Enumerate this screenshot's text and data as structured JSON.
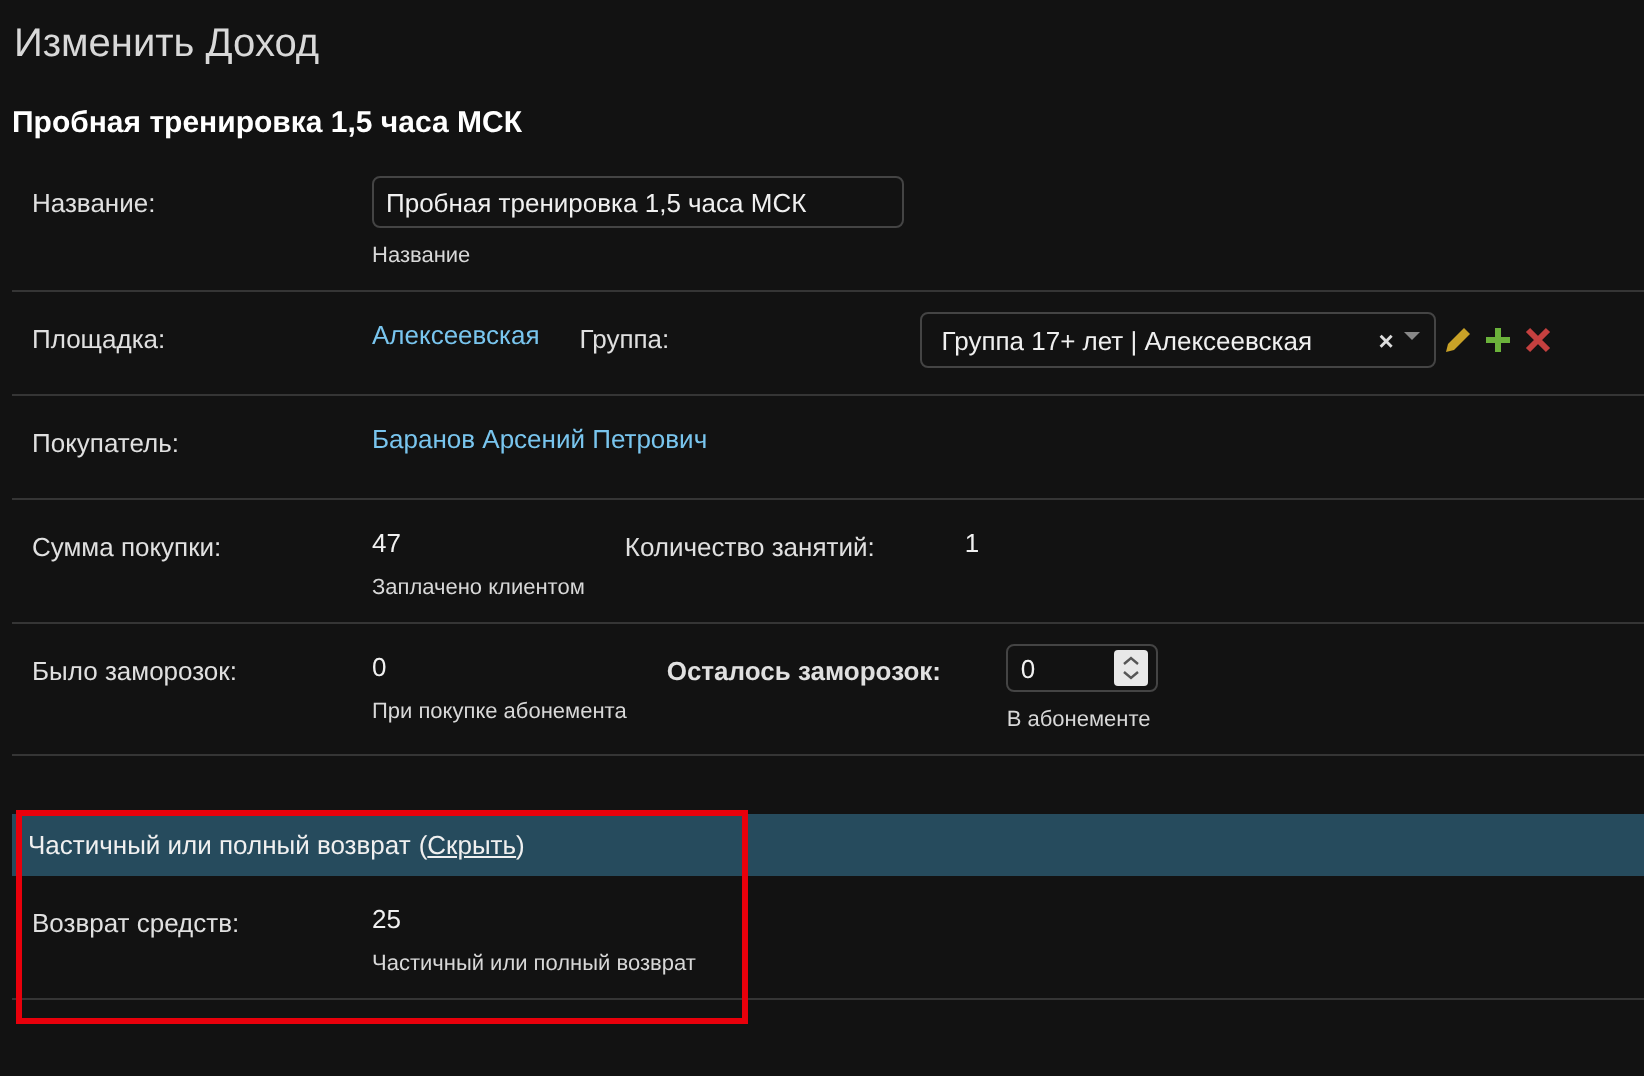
{
  "page_title": "Изменить Доход",
  "object_title": "Пробная тренировка 1,5 часа МСК",
  "rows": [
    {
      "fields": [
        {
          "label": "Название:",
          "required": false,
          "kind": "input",
          "value": "Пробная тренировка 1,5 часа МСК",
          "help": "Название"
        }
      ]
    },
    {
      "fields": [
        {
          "label": "Площадка:",
          "required": false,
          "kind": "link",
          "value": "Алексеевская"
        },
        {
          "label": "Группа:",
          "required": false,
          "kind": "select",
          "value": "Группа 17+ лет | Алексеевская",
          "clear": "×"
        }
      ]
    },
    {
      "fields": [
        {
          "label": "Покупатель:",
          "required": false,
          "kind": "link",
          "value": "Баранов Арсений Петрович"
        }
      ]
    },
    {
      "fields": [
        {
          "label": "Сумма покупки:",
          "required": false,
          "kind": "text",
          "value": "47",
          "help": "Заплачено клиентом"
        },
        {
          "label": "Количество занятий:",
          "required": false,
          "kind": "text",
          "value": "1"
        }
      ]
    },
    {
      "fields": [
        {
          "label": "Было заморозок:",
          "required": false,
          "kind": "text",
          "value": "0",
          "help": "При покупке абонемента"
        },
        {
          "label": "Осталось заморозок:",
          "required": true,
          "kind": "number",
          "value": "0",
          "help": "В абонементе"
        }
      ]
    }
  ],
  "collapsible": {
    "title": "Частичный или полный возврат",
    "toggle": {
      "open": "(",
      "label": "Скрыть",
      "close": ")"
    },
    "rows": [
      {
        "fields": [
          {
            "label": "Возврат средств:",
            "required": false,
            "kind": "text",
            "value": "25",
            "help": "Частичный или полный возврат"
          }
        ]
      }
    ]
  }
}
